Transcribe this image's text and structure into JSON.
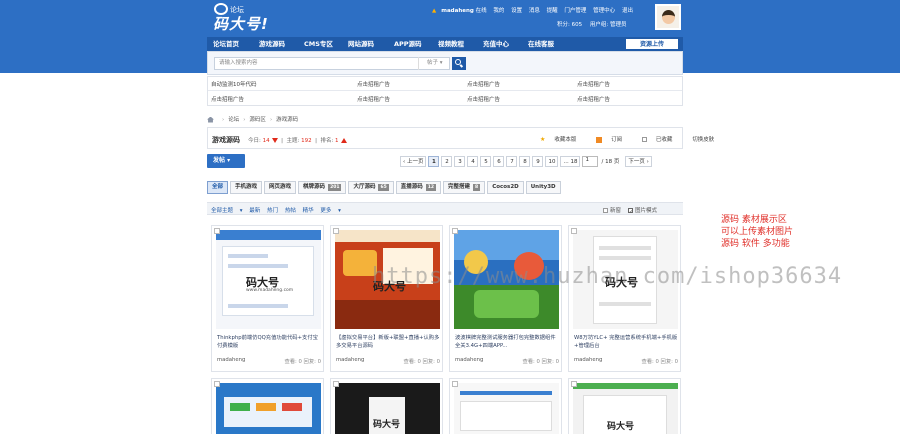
{
  "header": {
    "logo_sub": "论坛",
    "logo_brand": "码大号!",
    "user": {
      "name": "madaheng",
      "status": "在线",
      "links": [
        "我的",
        "设置",
        "消息",
        "提醒",
        "门户管理",
        "管理中心",
        "退出"
      ],
      "credits": "积分: 605",
      "group": "用户组: 管理员"
    }
  },
  "nav": {
    "items": [
      "论坛首页",
      "游戏源码",
      "CMS专区",
      "网站源码",
      "APP源码",
      "视频教程",
      "充值中心",
      "在线客服"
    ],
    "upload_label": "资源上传"
  },
  "search": {
    "placeholder": "请输入搜索内容",
    "type": "帖子"
  },
  "ads": {
    "rows": [
      [
        "自动监测10年代码",
        "点击招租广告",
        "点击招租广告",
        "点击招租广告"
      ],
      [
        "点击招租广告",
        "点击招租广告",
        "点击招租广告",
        "点击招租广告"
      ]
    ]
  },
  "breadcrumb": [
    "论坛",
    "源码区",
    "游戏源码"
  ],
  "forum": {
    "title": "游戏源码",
    "today_label": "今日:",
    "today_value": "14",
    "topics_label": "主题:",
    "topics_value": "192",
    "rank_label": "排名:",
    "rank_value": "1",
    "actions": [
      "收藏本版",
      "订阅",
      "已收藏",
      "切换皮肤"
    ]
  },
  "post_button": "发帖",
  "pager": {
    "prev": "上一页",
    "pages": [
      "1",
      "2",
      "3",
      "4",
      "5",
      "6",
      "7",
      "8",
      "9",
      "10",
      "... 18"
    ],
    "current": "1",
    "total": "/ 18 页",
    "next": "下一页"
  },
  "tabs": [
    {
      "label": "全部",
      "count": ""
    },
    {
      "label": "手机游戏",
      "count": ""
    },
    {
      "label": "网页游戏",
      "count": ""
    },
    {
      "label": "棋牌源码",
      "count": "201"
    },
    {
      "label": "大厅源码",
      "count": "65"
    },
    {
      "label": "直播源码",
      "count": "12"
    },
    {
      "label": "完整搭建",
      "count": "8"
    },
    {
      "label": "Cocos2D",
      "count": ""
    },
    {
      "label": "Unity3D",
      "count": ""
    }
  ],
  "filter": {
    "items": [
      "全部主题",
      "最新",
      "热门",
      "热帖",
      "精华",
      "更多"
    ],
    "new_window": "新窗",
    "grid_mode": "图片模式"
  },
  "cards": [
    {
      "title": "Thinkphp前端仿QQ充值功能代码+支付宝付费模版",
      "author": "madaheng",
      "stats": "查看: 0  回复: 0"
    },
    {
      "title": "【虚拟交易平台】新版+联盟+直播+认购多多交易平台源码",
      "author": "madaheng",
      "stats": "查看: 0  回复: 0"
    },
    {
      "title": "波波棋牌完整测试服务器打包完整数据组件全关3.4G+四端APP...",
      "author": "madaheng",
      "stats": "查看: 0  回复: 0"
    },
    {
      "title": "W8万坊YLC+ 完整运营系统手机端+手机版+管理后台",
      "author": "madaheng",
      "stats": "查看: 0  回复: 0"
    }
  ],
  "thumb_brand": "码大号",
  "thumb_url": "www.madaheng.com",
  "side_note": [
    "源码 素材展示区",
    "可以上传素材图片",
    "源码 软件 多功能"
  ],
  "watermark": "https://www.huzhan.com/ishop36634",
  "colors": {
    "header_blue": "#2d6fc4",
    "nav_blue": "#1f5aa8",
    "accent_red": "#e02a1a"
  }
}
